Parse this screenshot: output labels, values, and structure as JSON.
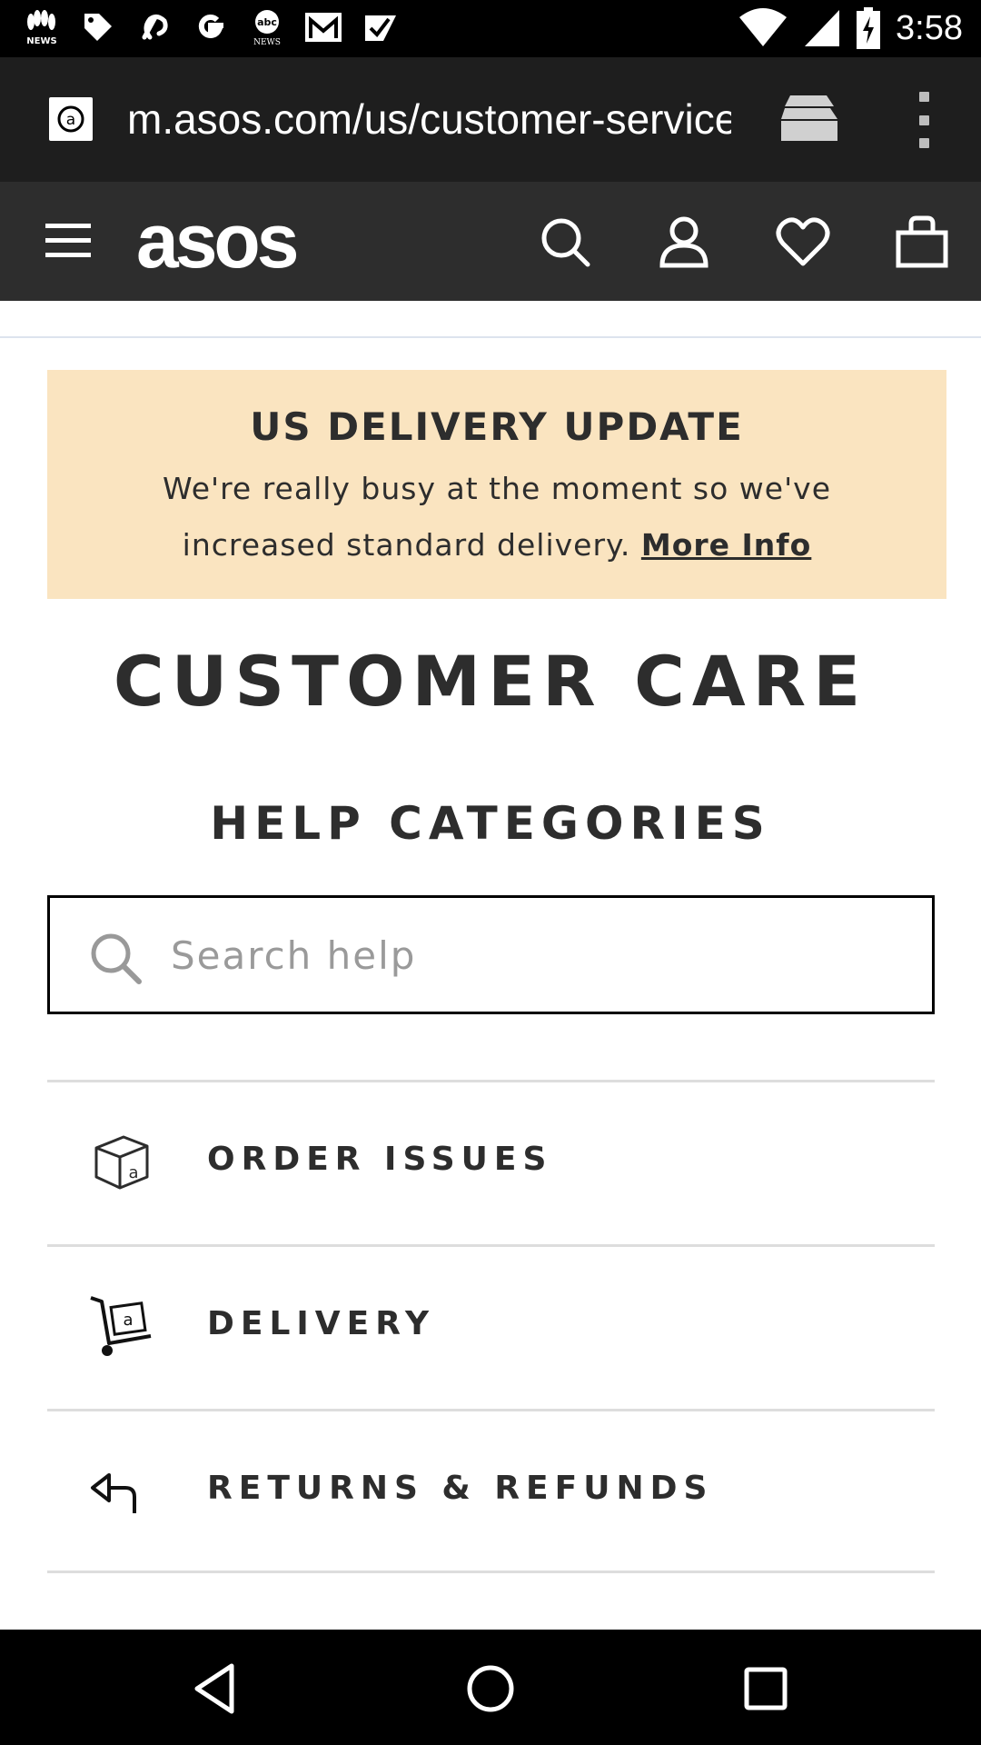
{
  "status_bar": {
    "time": "3:58",
    "notification_icons": [
      "nbc-news-icon",
      "tag-icon",
      "pinterest-icon",
      "google-icon",
      "abc-news-icon",
      "gmail-icon",
      "check-icon"
    ]
  },
  "browser": {
    "url": "m.asos.com/us/customer-service"
  },
  "header": {
    "logo": "asos"
  },
  "banner": {
    "title": "US DELIVERY UPDATE",
    "text": "We're really busy at the moment so we've increased standard delivery.",
    "link": "More Info",
    "background": "#fae4c0"
  },
  "page": {
    "title": "CUSTOMER CARE",
    "section_title": "HELP CATEGORIES"
  },
  "search": {
    "placeholder": "Search help"
  },
  "categories": [
    {
      "label": "ORDER ISSUES",
      "icon": "box-icon"
    },
    {
      "label": "DELIVERY",
      "icon": "trolley-icon"
    },
    {
      "label": "RETURNS & REFUNDS",
      "icon": "return-arrow-icon"
    }
  ],
  "colors": {
    "header": "#2d2d2d",
    "text": "#2d2d2d"
  }
}
